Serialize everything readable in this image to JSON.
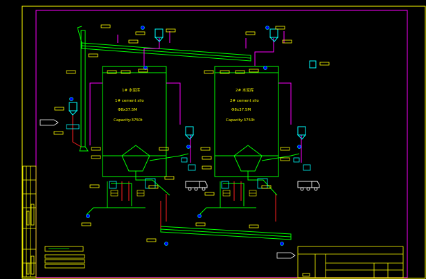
{
  "colors": {
    "background": "#000000",
    "frame": "#ffff00",
    "border": "#ff00ff",
    "structure": "#00ff00",
    "pipe": "#ff2020",
    "equipment": "#00ffff",
    "motor": "#0000ff",
    "label": "#ffff00",
    "white": "#ffffff"
  },
  "silo1": {
    "title_cn": "1# 水泥库",
    "title_en": "1# cement silo",
    "size": "Φ8x37.5M",
    "capacity": "Capacity:3750t"
  },
  "silo2": {
    "title_cn": "2# 水泥库",
    "title_en": "2# cement silo",
    "size": "Φ8x37.5M",
    "capacity": "Capacity:3750t"
  },
  "icons": [
    "dust-collector-icon",
    "bucket-elevator-icon",
    "cement-truck-icon",
    "air-slide-icon",
    "motor-icon"
  ]
}
